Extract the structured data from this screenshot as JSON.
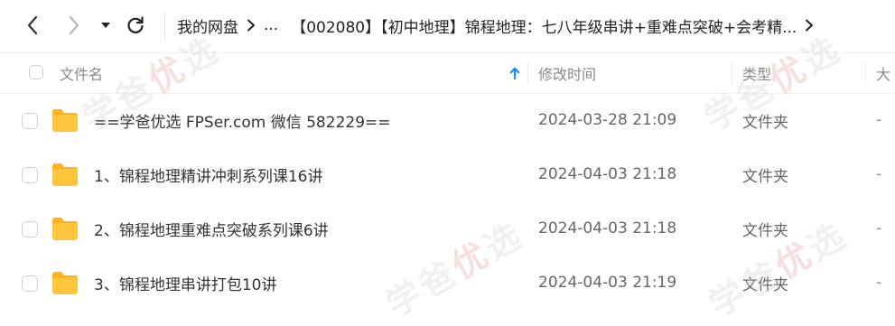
{
  "toolbar": {
    "back_icon": "chevron-left-icon",
    "forward_icon": "chevron-right-icon",
    "dropdown_icon": "caret-down-icon",
    "refresh_icon": "refresh-icon"
  },
  "breadcrumb": {
    "root": "我的网盘",
    "ellipsis": "...",
    "current": "【002080】【初中地理】锦程地理：七八年级串讲+重难点突破+会考精...",
    "separator_icon": "chevron-right-icon"
  },
  "header": {
    "name": "文件名",
    "sort_icon": "arrow-up-icon",
    "mtime": "修改时间",
    "type": "类型",
    "size": "大"
  },
  "rows": [
    {
      "name": "==学爸优选 FPSer.com 微信 582229==",
      "mtime": "2024-03-28 21:09",
      "type": "文件夹",
      "size": "-"
    },
    {
      "name": "1、锦程地理精讲冲刺系列课16讲",
      "mtime": "2024-04-03 21:18",
      "type": "文件夹",
      "size": "-"
    },
    {
      "name": "2、锦程地理重难点突破系列课6讲",
      "mtime": "2024-04-03 21:18",
      "type": "文件夹",
      "size": "-"
    },
    {
      "name": "3、锦程地理串讲打包10讲",
      "mtime": "2024-04-03 21:19",
      "type": "文件夹",
      "size": "-"
    }
  ],
  "watermark": {
    "left": "学爸",
    "mid": "优",
    "right": "选"
  },
  "colors": {
    "accent": "#1a8cff",
    "folder": "#ffc53d",
    "folder_tab": "#ffb21e"
  }
}
